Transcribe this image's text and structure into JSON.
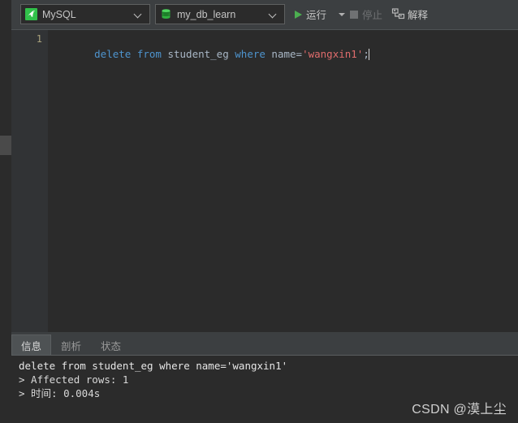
{
  "toolbar": {
    "connection": {
      "icon": "mysql-dolphin-icon",
      "label": "MySQL"
    },
    "database": {
      "icon": "database-cylinder-icon",
      "label": "my_db_learn"
    },
    "run": {
      "icon": "play-icon",
      "label": "运行"
    },
    "run_dropdown": {
      "icon": "chevron-down-icon"
    },
    "stop": {
      "icon": "stop-square-icon",
      "label": "停止",
      "enabled": false
    },
    "explain": {
      "icon": "explain-plan-icon",
      "label": "解释"
    }
  },
  "editor": {
    "line_number": "1",
    "tokens": [
      {
        "text": "delete",
        "type": "keyword"
      },
      {
        "text": " ",
        "type": "plain"
      },
      {
        "text": "from",
        "type": "keyword"
      },
      {
        "text": " student_eg ",
        "type": "identifier"
      },
      {
        "text": "where",
        "type": "keyword"
      },
      {
        "text": " name",
        "type": "identifier"
      },
      {
        "text": "=",
        "type": "operator"
      },
      {
        "text": "'wangxin1'",
        "type": "string"
      },
      {
        "text": ";",
        "type": "operator"
      }
    ],
    "full_text": "delete from student_eg where name='wangxin1';"
  },
  "bottom_panel": {
    "tabs": [
      {
        "label": "信息",
        "active": true
      },
      {
        "label": "剖析",
        "active": false
      },
      {
        "label": "状态",
        "active": false
      }
    ],
    "console_lines": [
      "delete from student_eg where name='wangxin1'",
      "> Affected rows: 1",
      "> 时间: 0.004s"
    ]
  },
  "watermark": {
    "text": "CSDN @漠上尘"
  },
  "colors": {
    "background": "#3c3f41",
    "editor_background": "#2b2b2b",
    "gutter": "#313335",
    "accent_green": "#31c14a",
    "play_green": "#4caf50",
    "keyword_blue": "#4e94ce",
    "string_red": "#e06c6c",
    "identifier": "#a9b7c6",
    "line_number": "#a9a27c"
  }
}
